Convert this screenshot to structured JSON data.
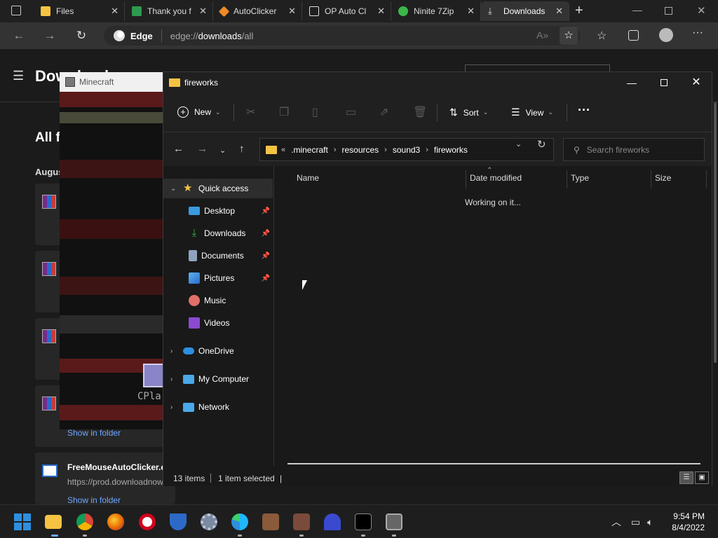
{
  "browser": {
    "tabs": [
      {
        "label": "Files",
        "color": "#f5c342"
      },
      {
        "label": "Thank you f",
        "color": "#2e9a4f"
      },
      {
        "label": "AutoClicker",
        "color": "#ef8a2a"
      },
      {
        "label": "OP Auto Cl",
        "color": "#ffffff"
      },
      {
        "label": "Ninite 7Zip",
        "color": "#3cb54a"
      },
      {
        "label": "Downloads",
        "color": "#cccccc"
      }
    ],
    "profile_label": "Edge",
    "url_prefix": "edge://",
    "url_path": "downloads",
    "url_suffix": "/all"
  },
  "downloads_page": {
    "title": "Downloads",
    "section_title": "All f",
    "date_group": "Augus",
    "show_in_folder_1": "Show in folder",
    "item_name": "FreeMouseAutoClicker.e",
    "item_url": "https://prod.downloadnow",
    "show_in_folder_2": "Show in folder"
  },
  "minecraft": {
    "window_title": "Minecraft",
    "overlay_text": "CPla"
  },
  "explorer": {
    "window_title": "fireworks",
    "toolbar": {
      "new_label": "New",
      "sort_label": "Sort",
      "view_label": "View",
      "more_label": "···"
    },
    "breadcrumb": [
      ".minecraft",
      "resources",
      "sound3",
      "fireworks"
    ],
    "breadcrumb_overflow": "«",
    "search_placeholder": "Search fireworks",
    "nav": {
      "quick_access": "Quick access",
      "desktop": "Desktop",
      "downloads": "Downloads",
      "documents": "Documents",
      "pictures": "Pictures",
      "music": "Music",
      "videos": "Videos",
      "onedrive": "OneDrive",
      "my_computer": "My Computer",
      "network": "Network"
    },
    "columns": {
      "name": "Name",
      "date_modified": "Date modified",
      "type": "Type",
      "size": "Size"
    },
    "status_message": "Working on it...",
    "status_bar": {
      "item_count": "13 items",
      "selection": "1 item selected",
      "caret": "|"
    }
  },
  "taskbar": {
    "time": "9:54 PM",
    "date": "8/4/2022"
  }
}
